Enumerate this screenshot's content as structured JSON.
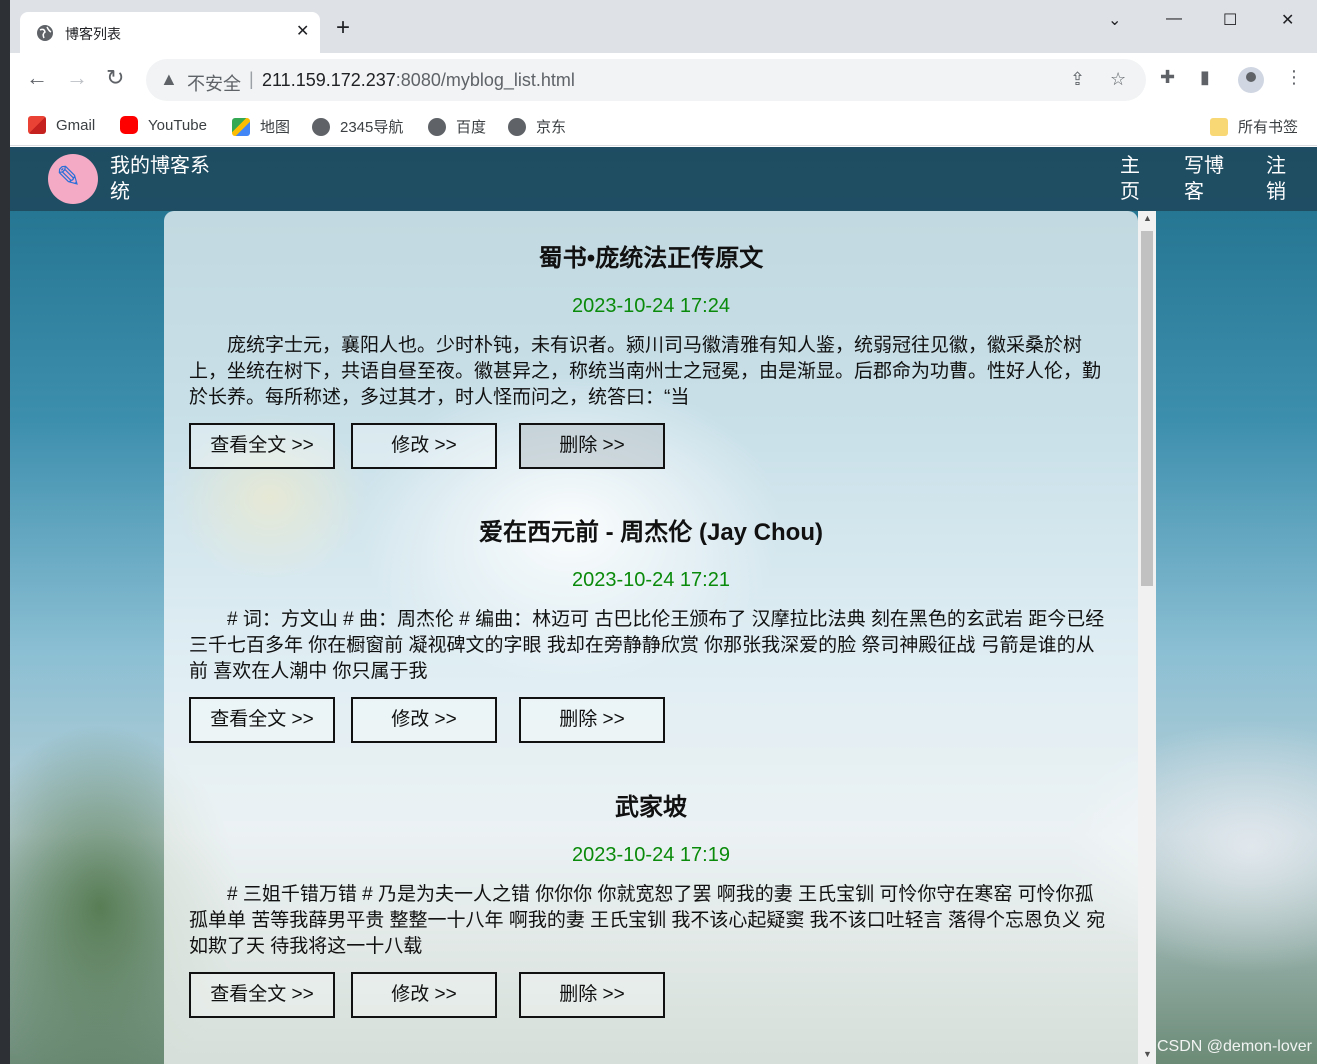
{
  "browser": {
    "tab_title": "博客列表",
    "new_tab": "+",
    "security_label": "不安全",
    "url_host": "211.159.172.237",
    "url_rest": ":8080/myblog_list.html",
    "bookmarks": [
      "Gmail",
      "YouTube",
      "地图",
      "2345导航",
      "百度",
      "京东"
    ],
    "all_bookmarks": "所有书签"
  },
  "site": {
    "title": "我的博客系统",
    "nav": [
      "主页",
      "写博客",
      "注销"
    ]
  },
  "blogs": [
    {
      "title": "蜀书•庞统法正传原文",
      "date": "2023-10-24 17:24",
      "desc": "庞统字士元，襄阳人也。少时朴钝，未有识者。颍川司马徽清雅有知人鉴，统弱冠往见徽，徽采桑於树上，坐统在树下，共语自昼至夜。徽甚异之，称统当南州士之冠冕，由是渐显。后郡命为功曹。性好人伦，勤於长养。每所称述，多过其才，时人怪而问之，统答曰：“当"
    },
    {
      "title": "爱在西元前 - 周杰伦 (Jay Chou)",
      "date": "2023-10-24 17:21",
      "desc": "# 词：方文山 # 曲：周杰伦 # 编曲：林迈可 古巴比伦王颁布了 汉摩拉比法典 刻在黑色的玄武岩 距今已经三千七百多年 你在橱窗前 凝视碑文的字眼 我却在旁静静欣赏 你那张我深爱的脸 祭司神殿征战 弓箭是谁的从前 喜欢在人潮中 你只属于我"
    },
    {
      "title": "武家坡",
      "date": "2023-10-24 17:19",
      "desc": "# 三姐千错万错 # 乃是为夫一人之错 你你你 你就宽恕了罢 啊我的妻 王氏宝钏 可怜你守在寒窑 可怜你孤孤单单 苦等我薛男平贵 整整一十八年 啊我的妻 王氏宝钏 我不该心起疑窦 我不该口吐轻言 落得个忘恩负义 宛如欺了天 待我将这一十八载"
    }
  ],
  "buttons": {
    "view": "查看全文 >>",
    "edit": "修改 >>",
    "delete": "删除 >>"
  },
  "watermark": "CSDN @demon-lover"
}
